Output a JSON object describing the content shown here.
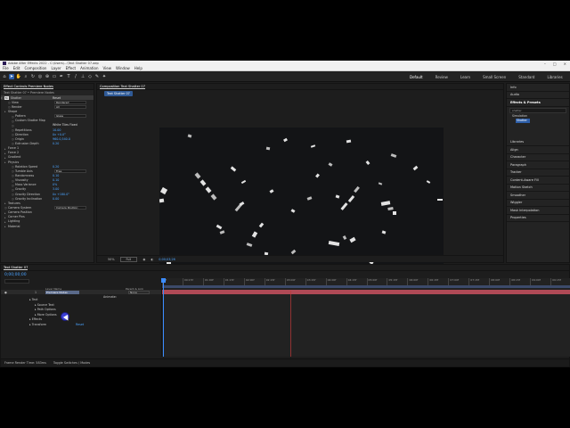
{
  "window": {
    "title": "Adobe After Effects 2022 - C:\\Users\\...\\Text Shatter 07.aep"
  },
  "menu": [
    "File",
    "Edit",
    "Composition",
    "Layer",
    "Effect",
    "Animation",
    "View",
    "Window",
    "Help"
  ],
  "workspaces": [
    {
      "label": "Default",
      "selected": true
    },
    {
      "label": "Review",
      "selected": false
    },
    {
      "label": "Learn",
      "selected": false
    },
    {
      "label": "Small Screen",
      "selected": false
    },
    {
      "label": "Standard",
      "selected": false
    },
    {
      "label": "Libraries",
      "selected": false
    }
  ],
  "effect_controls": {
    "tab": "Effect Controls Premiere Nodes",
    "subtitle": "Text Shatter 07 • Premiere Nodes",
    "effect_name": "Shatter",
    "reset": "Reset",
    "rows": [
      {
        "label": "View",
        "value": "Rendered",
        "kind": "box"
      },
      {
        "label": "Render",
        "value": "All",
        "kind": "box"
      },
      {
        "label": "Shape",
        "value": "",
        "kind": "group"
      },
      {
        "label": "Pattern",
        "value": "Glass",
        "kind": "box"
      },
      {
        "label": "Custom Shatter Map",
        "value": "",
        "kind": "plain"
      },
      {
        "label": "",
        "value": "White Tiles Fixed",
        "kind": "check"
      },
      {
        "label": "Repetitions",
        "value": "10.00",
        "kind": "val"
      },
      {
        "label": "Direction",
        "value": "0x +0.0°",
        "kind": "val"
      },
      {
        "label": "Origin",
        "value": "960.0,540.0",
        "kind": "val"
      },
      {
        "label": "Extrusion Depth",
        "value": "0.20",
        "kind": "val"
      },
      {
        "label": "Force 1",
        "value": "",
        "kind": "group"
      },
      {
        "label": "Force 2",
        "value": "",
        "kind": "group"
      },
      {
        "label": "Gradient",
        "value": "",
        "kind": "group"
      },
      {
        "label": "Physics",
        "value": "",
        "kind": "group"
      },
      {
        "label": "Rotation Speed",
        "value": "0.20",
        "kind": "val"
      },
      {
        "label": "Tumble Axis",
        "value": "Free",
        "kind": "box"
      },
      {
        "label": "Randomness",
        "value": "0.10",
        "kind": "val"
      },
      {
        "label": "Viscosity",
        "value": "0.10",
        "kind": "val"
      },
      {
        "label": "Mass Variance",
        "value": "0%",
        "kind": "val"
      },
      {
        "label": "Gravity",
        "value": "3.00",
        "kind": "val"
      },
      {
        "label": "Gravity Direction",
        "value": "0x +180.0°",
        "kind": "val"
      },
      {
        "label": "Gravity Inclination",
        "value": "0.00",
        "kind": "val"
      },
      {
        "label": "Textures",
        "value": "",
        "kind": "group"
      },
      {
        "label": "Camera System",
        "value": "Camera Position",
        "kind": "box"
      },
      {
        "label": "Camera Position",
        "value": "",
        "kind": "group"
      },
      {
        "label": "Corner Pins",
        "value": "",
        "kind": "group"
      },
      {
        "label": "Lighting",
        "value": "",
        "kind": "group"
      },
      {
        "label": "Material",
        "value": "",
        "kind": "group"
      }
    ]
  },
  "composition": {
    "tab": "Composition Text Shatter 07",
    "chip": "Text Shatter 07",
    "zoom": "50%",
    "quality": "Full",
    "timecode": "0;00;03;26"
  },
  "right_panel": {
    "items_top": [
      "Info",
      "Audio"
    ],
    "effects_title": "Effects & Presets",
    "search_value": "shatter",
    "category": "Simulation",
    "result": "Shatter",
    "items": [
      "Libraries",
      "Align",
      "Character",
      "Paragraph",
      "Tracker",
      "Content-Aware Fill",
      "Motion Sketch",
      "Smoother",
      "Wiggler",
      "Mask Interpolation",
      "Properties"
    ]
  },
  "timeline": {
    "tab": "Text Shatter 07",
    "time": "0;00;00;00",
    "columns": {
      "source": "Layer Name",
      "parent": "Parent & Link",
      "mode": "Mode"
    },
    "layer": {
      "num": "1",
      "name": "Premiere Nodes",
      "mode": "None"
    },
    "animate": "Animate:",
    "props": [
      {
        "label": "Text",
        "indent": 1,
        "value": ""
      },
      {
        "label": "Source Text",
        "indent": 2,
        "value": ""
      },
      {
        "label": "Path Options",
        "indent": 2,
        "value": ""
      },
      {
        "label": "More Options",
        "indent": 2,
        "value": ""
      },
      {
        "label": "Effects",
        "indent": 1,
        "value": ""
      },
      {
        "label": "Transform",
        "indent": 1,
        "value": "Reset"
      }
    ],
    "ruler": [
      "0f",
      "00:15f",
      "01:00f",
      "01:15f",
      "02:00f",
      "02:15f",
      "03:00f",
      "03:15f",
      "04:00f",
      "04:15f",
      "05:00f",
      "05:15f",
      "06:00f",
      "06:15f",
      "07:00f",
      "07:15f",
      "08:00f",
      "08:15f",
      "09:00f",
      "09:15f"
    ],
    "footer_render": "Frame Render Time: 583ms",
    "footer_toggle": "Toggle Switches / Modes"
  }
}
